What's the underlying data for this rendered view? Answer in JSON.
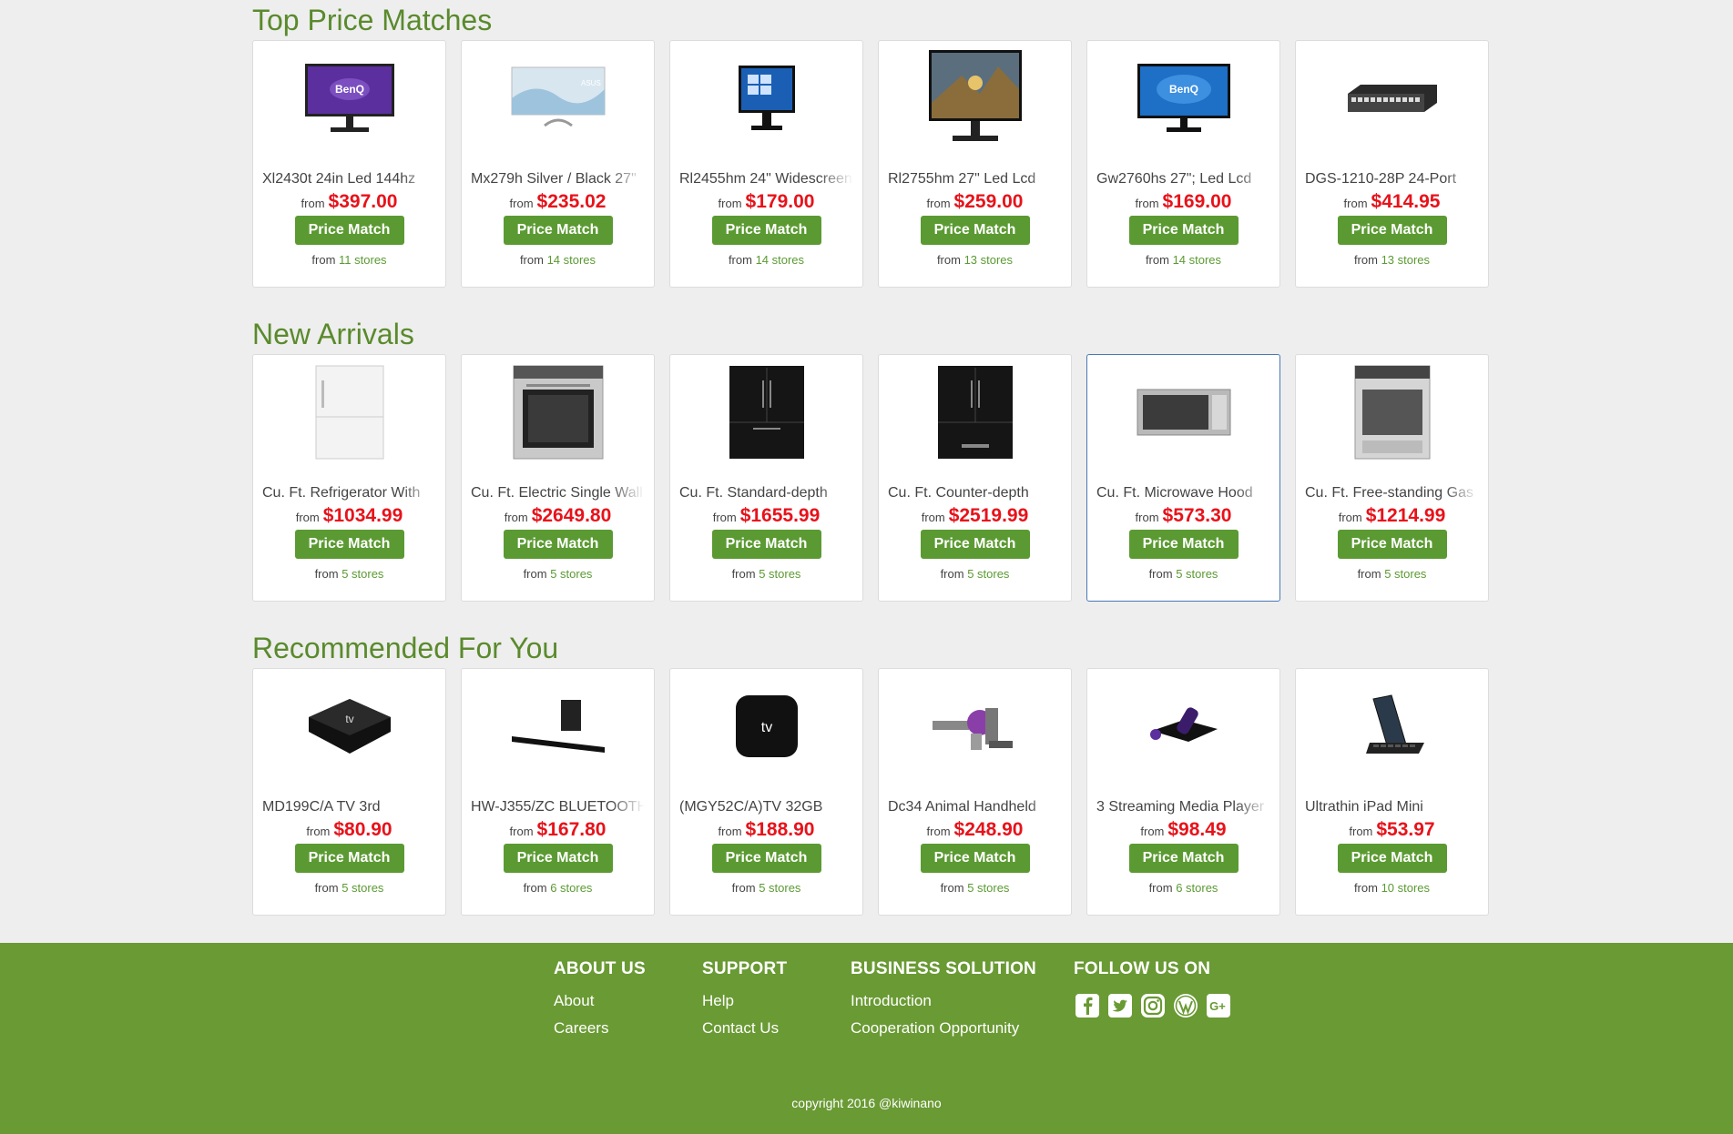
{
  "sections": [
    {
      "title": "Top Price Matches",
      "items": [
        {
          "name": "Xl2430t 24in Led 144hz",
          "from": "from",
          "price": "$397.00",
          "button": "Price Match",
          "stores_prefix": "from",
          "stores": "11 stores",
          "icon": "monitor-benq-purple"
        },
        {
          "name": "Mx279h Silver / Black 27\"",
          "from": "from",
          "price": "$235.02",
          "button": "Price Match",
          "stores_prefix": "from",
          "stores": "14 stores",
          "icon": "monitor-asus-slim"
        },
        {
          "name": "Rl2455hm 24\" Widescreen",
          "from": "from",
          "price": "$179.00",
          "button": "Price Match",
          "stores_prefix": "from",
          "stores": "14 stores",
          "icon": "monitor-windows"
        },
        {
          "name": "Rl2755hm 27\" Led Lcd",
          "from": "from",
          "price": "$259.00",
          "button": "Price Match",
          "stores_prefix": "from",
          "stores": "13 stores",
          "icon": "monitor-gaming"
        },
        {
          "name": "Gw2760hs 27\"; Led Lcd",
          "from": "from",
          "price": "$169.00",
          "button": "Price Match",
          "stores_prefix": "from",
          "stores": "14 stores",
          "icon": "monitor-benq-blue"
        },
        {
          "name": "DGS-1210-28P 24-Port",
          "from": "from",
          "price": "$414.95",
          "button": "Price Match",
          "stores_prefix": "from",
          "stores": "13 stores",
          "icon": "network-switch"
        }
      ]
    },
    {
      "title": "New Arrivals",
      "items": [
        {
          "name": "Cu. Ft. Refrigerator With",
          "from": "from",
          "price": "$1034.99",
          "button": "Price Match",
          "stores_prefix": "from",
          "stores": "5 stores",
          "icon": "refrigerator-white"
        },
        {
          "name": "Cu. Ft. Electric Single Wall",
          "from": "from",
          "price": "$2649.80",
          "button": "Price Match",
          "stores_prefix": "from",
          "stores": "5 stores",
          "icon": "wall-oven"
        },
        {
          "name": "Cu. Ft. Standard-depth",
          "from": "from",
          "price": "$1655.99",
          "button": "Price Match",
          "stores_prefix": "from",
          "stores": "5 stores",
          "icon": "refrigerator-black"
        },
        {
          "name": "Cu. Ft. Counter-depth",
          "from": "from",
          "price": "$2519.99",
          "button": "Price Match",
          "stores_prefix": "from",
          "stores": "5 stores",
          "icon": "refrigerator-black"
        },
        {
          "name": "Cu. Ft. Microwave Hood",
          "from": "from",
          "price": "$573.30",
          "button": "Price Match",
          "stores_prefix": "from",
          "stores": "5 stores",
          "icon": "microwave"
        },
        {
          "name": "Cu. Ft. Free-standing Gas",
          "from": "from",
          "price": "$1214.99",
          "button": "Price Match",
          "stores_prefix": "from",
          "stores": "5 stores",
          "icon": "gas-range"
        }
      ]
    },
    {
      "title": "Recommended For You",
      "items": [
        {
          "name": "MD199C/A TV 3rd",
          "from": "from",
          "price": "$80.90",
          "button": "Price Match",
          "stores_prefix": "from",
          "stores": "5 stores",
          "icon": "apple-tv-box"
        },
        {
          "name": "HW-J355/ZC BLUETOOTH",
          "from": "from",
          "price": "$167.80",
          "button": "Price Match",
          "stores_prefix": "from",
          "stores": "6 stores",
          "icon": "soundbar"
        },
        {
          "name": "(MGY52C/A)TV 32GB",
          "from": "from",
          "price": "$188.90",
          "button": "Price Match",
          "stores_prefix": "from",
          "stores": "5 stores",
          "icon": "apple-tv-square"
        },
        {
          "name": "Dc34 Animal Handheld",
          "from": "from",
          "price": "$248.90",
          "button": "Price Match",
          "stores_prefix": "from",
          "stores": "5 stores",
          "icon": "handheld-vacuum"
        },
        {
          "name": "3 Streaming Media Player",
          "from": "from",
          "price": "$98.49",
          "button": "Price Match",
          "stores_prefix": "from",
          "stores": "6 stores",
          "icon": "roku-player"
        },
        {
          "name": "Ultrathin iPad Mini",
          "from": "from",
          "price": "$53.97",
          "button": "Price Match",
          "stores_prefix": "from",
          "stores": "10 stores",
          "icon": "ipad-keyboard"
        }
      ]
    }
  ],
  "footer": {
    "about": {
      "title": "ABOUT US",
      "links": [
        "About",
        "Careers"
      ]
    },
    "support": {
      "title": "SUPPORT",
      "links": [
        "Help",
        "Contact Us"
      ]
    },
    "business": {
      "title": "BUSINESS SOLUTION",
      "links": [
        "Introduction",
        "Cooperation Opportunity"
      ]
    },
    "follow": {
      "title": "FOLLOW US ON",
      "icons": [
        "facebook-icon",
        "twitter-icon",
        "instagram-icon",
        "wordpress-icon",
        "google-plus-icon"
      ]
    },
    "copyright": "copyright 2016 @kiwinano"
  },
  "colors": {
    "accent": "#5b9a32",
    "price": "#e8121a",
    "footer_bg": "#6a9a34",
    "focus_border": "#4a78b5"
  }
}
